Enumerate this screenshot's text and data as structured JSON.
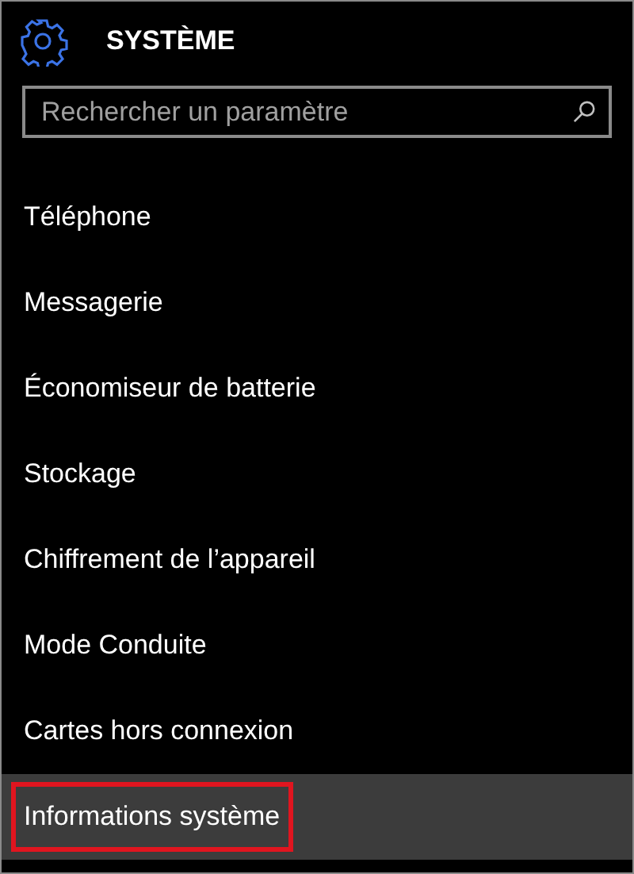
{
  "header": {
    "title": "SYSTÈME"
  },
  "search": {
    "placeholder": "Rechercher un paramètre"
  },
  "items": [
    {
      "label": "Téléphone",
      "selected": false,
      "highlighted": false
    },
    {
      "label": "Messagerie",
      "selected": false,
      "highlighted": false
    },
    {
      "label": "Économiseur de batterie",
      "selected": false,
      "highlighted": false
    },
    {
      "label": "Stockage",
      "selected": false,
      "highlighted": false
    },
    {
      "label": "Chiffrement de l’appareil",
      "selected": false,
      "highlighted": false
    },
    {
      "label": "Mode Conduite",
      "selected": false,
      "highlighted": false
    },
    {
      "label": "Cartes hors connexion",
      "selected": false,
      "highlighted": false
    },
    {
      "label": "Informations système",
      "selected": true,
      "highlighted": true
    }
  ]
}
